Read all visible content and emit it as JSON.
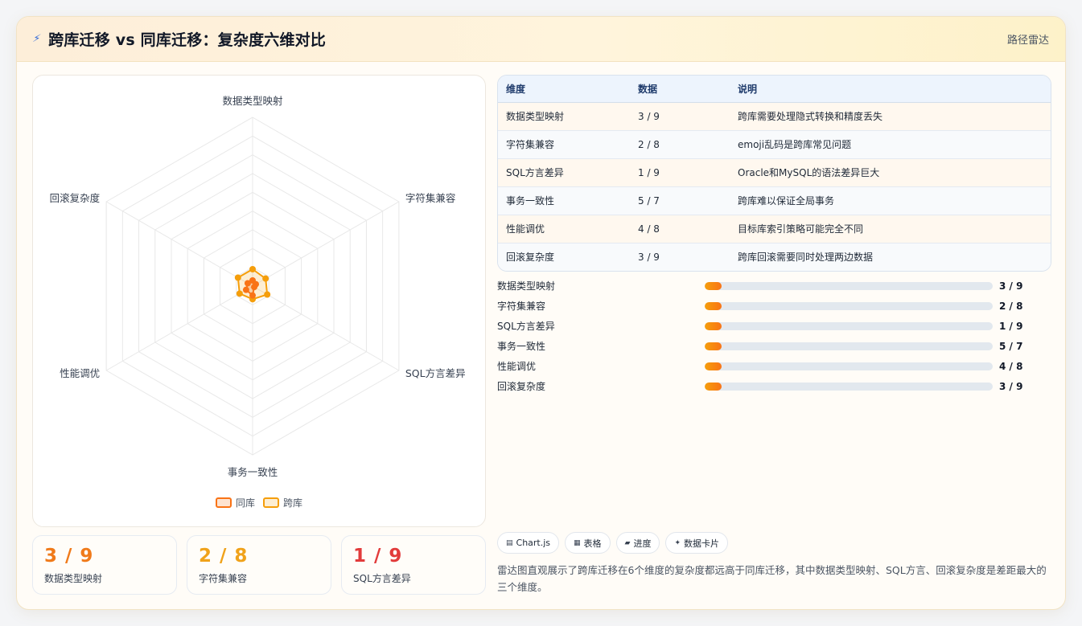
{
  "header": {
    "title": "跨库迁移 vs 同库迁移：复杂度六维对比",
    "right_label": "路径雷达"
  },
  "chart_data": {
    "type": "radar",
    "axes": [
      "数据类型映射",
      "字符集兼容",
      "SQL方言差异",
      "事务一致性",
      "性能调优",
      "回滚复杂度"
    ],
    "rlim": [
      0,
      90
    ],
    "grid": true,
    "series": [
      {
        "name": "同库",
        "values": [
          3,
          2,
          1,
          5,
          4,
          3
        ],
        "color": "#f97316"
      },
      {
        "name": "跨库",
        "values": [
          9,
          8,
          9,
          7,
          8,
          9
        ],
        "color": "#f59e0b"
      }
    ],
    "legend": "bottom-center"
  },
  "stats": [
    {
      "value": "3 / 9",
      "label": "数据类型映射",
      "color": "#f07a1a"
    },
    {
      "value": "2 / 8",
      "label": "字符集兼容",
      "color": "#f0a21a"
    },
    {
      "value": "1 / 9",
      "label": "SQL方言差异",
      "color": "#e23b3b"
    }
  ],
  "table": {
    "headers": [
      "维度",
      "数据",
      "说明"
    ],
    "rows": [
      [
        "数据类型映射",
        "3 / 9",
        "跨库需要处理隐式转换和精度丢失"
      ],
      [
        "字符集兼容",
        "2 / 8",
        "emoji乱码是跨库常见问题"
      ],
      [
        "SQL方言差异",
        "1 / 9",
        "Oracle和MySQL的语法差异巨大"
      ],
      [
        "事务一致性",
        "5 / 7",
        "跨库难以保证全局事务"
      ],
      [
        "性能调优",
        "4 / 8",
        "目标库索引策略可能完全不同"
      ],
      [
        "回滚复杂度",
        "3 / 9",
        "跨库回滚需要同时处理两边数据"
      ]
    ]
  },
  "progress": [
    {
      "label": "数据类型映射",
      "value": "3 / 9",
      "fill": 0.06
    },
    {
      "label": "字符集兼容",
      "value": "2 / 8",
      "fill": 0.06
    },
    {
      "label": "SQL方言差异",
      "value": "1 / 9",
      "fill": 0.06
    },
    {
      "label": "事务一致性",
      "value": "5 / 7",
      "fill": 0.06
    },
    {
      "label": "性能调优",
      "value": "4 / 8",
      "fill": 0.06
    },
    {
      "label": "回滚复杂度",
      "value": "3 / 9",
      "fill": 0.06
    }
  ],
  "tags": [
    {
      "icon": "▤",
      "label": "Chart.js",
      "icon_name": "chart-icon"
    },
    {
      "icon": "▦",
      "label": "表格",
      "icon_name": "table-icon"
    },
    {
      "icon": "▰",
      "label": "进度",
      "icon_name": "progress-icon"
    },
    {
      "icon": "✦",
      "label": "数据卡片",
      "icon_name": "sparkle-icon"
    }
  ],
  "summary": "雷达图直观展示了跨库迁移在6个维度的复杂度都远高于同库迁移，其中数据类型映射、SQL方言、回滚复杂度是差距最大的三个维度。"
}
